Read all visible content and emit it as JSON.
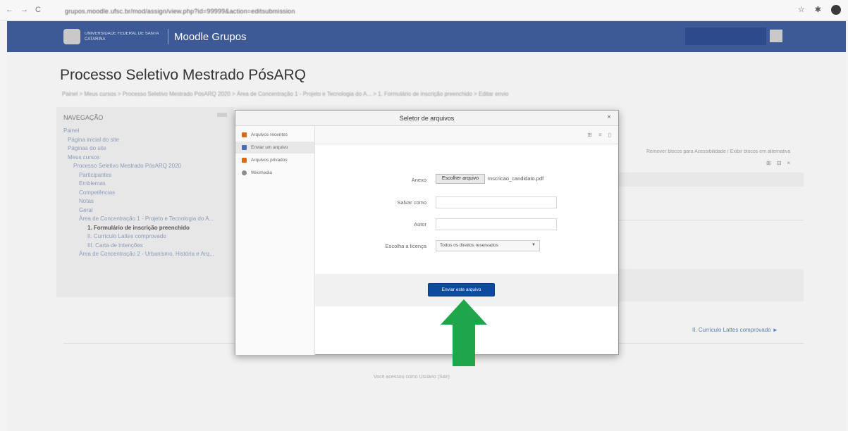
{
  "browser": {
    "nav_icons": [
      "←",
      "→",
      "C"
    ],
    "url": "grupos.moodle.ufsc.br/mod/assign/view.php?id=99999&action=editsubmission",
    "right_icons": [
      "☆",
      "✱"
    ]
  },
  "topbar": {
    "university": "UNIVERSIDADE FEDERAL DE SANTA CATARINA",
    "site_name": "Moodle Grupos"
  },
  "page": {
    "title": "Processo Seletivo Mestrado PósARQ",
    "breadcrumb": "Painel  >  Meus cursos  >  Processo Seletivo Mestrado PósARQ 2020  >  Área de Concentração 1 - Projeto e Tecnologia do A...  >  1. Formulário de inscrição preenchido  >  Editar envio"
  },
  "navigation": {
    "title": "NAVEGAÇÃO",
    "items": [
      "Painel",
      "Página inicial do site",
      "Páginas do site",
      "Meus cursos",
      "Processo Seletivo Mestrado PósARQ 2020",
      "Participantes",
      "Emblemas",
      "Competências",
      "Notas",
      "Geral",
      "Área de Concentração 1 - Projeto e Tecnologia do A...",
      "1. Formulário de inscrição preenchido",
      "II. Currículo Lattes comprovado",
      "III. Carta de Intenções",
      "Área de Concentração 2 - Urbanismo, História e Arq..."
    ]
  },
  "right": {
    "link": "Remover blocos para Acessibilidade / Exibir blocos em alternativa",
    "icons": [
      "⊞",
      "⊟",
      "×"
    ],
    "row_text": "",
    "next_link": "II. Currículo Lattes comprovado ►",
    "footer_text": "Você acessou como Usuário (Sair)"
  },
  "dialog": {
    "title": "Seletor de arquivos",
    "close": "×",
    "repositories": [
      {
        "label": "Arquivos recentes",
        "color": "#d46a1c"
      },
      {
        "label": "Enviar um arquivo",
        "color": "#4a6fb5"
      },
      {
        "label": "Arquivos privados",
        "color": "#d46a1c"
      },
      {
        "label": "Wikimedia",
        "color": "#8a8a8a"
      }
    ],
    "toolbar_icons": [
      "⊞",
      "≡",
      "▯"
    ],
    "form": {
      "anexo_label": "Anexo",
      "choose_button": "Escolher arquivo",
      "file_name": "Inscricao_candidato.pdf",
      "save_as_label": "Salvar como",
      "author_label": "Autor",
      "license_label": "Escolha a licença",
      "license_value": "Todos os direitos reservados",
      "upload_button": "Enviar este arquivo"
    }
  },
  "annotation": {
    "arrow_color": "#1fa64a"
  }
}
